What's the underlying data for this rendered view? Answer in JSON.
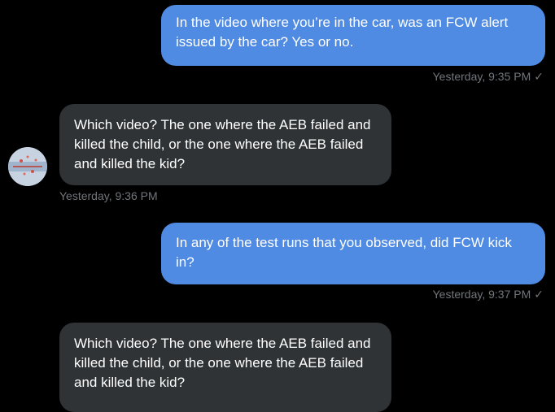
{
  "messages": [
    {
      "direction": "outgoing",
      "text": "In the video where you’re in the car, was an FCW alert issued by the car? Yes or no.",
      "timestamp": "Yesterday, 9:35 PM",
      "status_icon": "checkmark-icon"
    },
    {
      "direction": "incoming",
      "text": "Which video? The one where the AEB failed and killed the child, or the one where the AEB failed and killed the kid?",
      "timestamp": "Yesterday, 9:36 PM"
    },
    {
      "direction": "outgoing",
      "text": "In any of the test runs that you observed, did FCW kick in?",
      "timestamp": "Yesterday, 9:37 PM",
      "status_icon": "checkmark-icon"
    },
    {
      "direction": "incoming",
      "text": "Which video? The one where the AEB failed and killed the child, or the one where the AEB failed and killed the kid?"
    }
  ],
  "check_glyph": "✓",
  "colors": {
    "background": "#000000",
    "outgoing_bubble": "#4f8ae3",
    "incoming_bubble": "#2f3336",
    "meta_text": "#71767b"
  }
}
